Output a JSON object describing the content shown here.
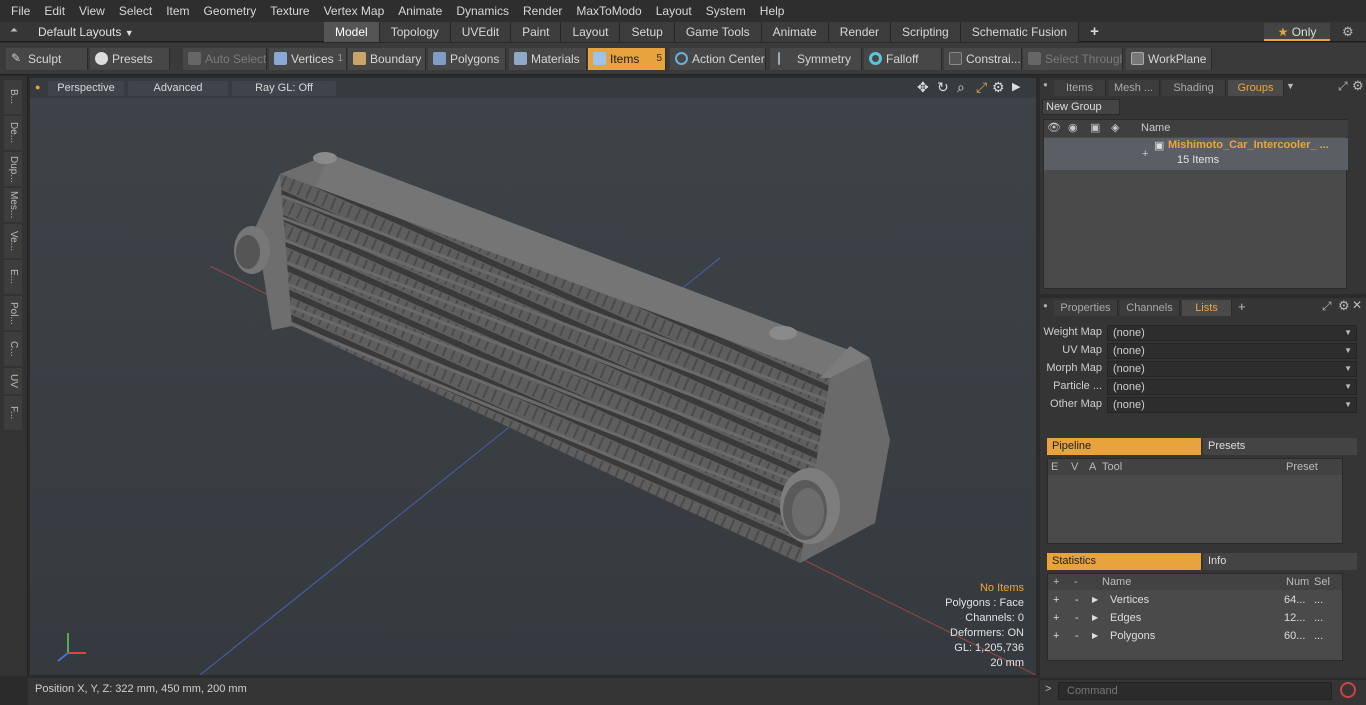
{
  "menu": [
    "File",
    "Edit",
    "View",
    "Select",
    "Item",
    "Geometry",
    "Texture",
    "Vertex Map",
    "Animate",
    "Dynamics",
    "Render",
    "MaxToModo",
    "Layout",
    "System",
    "Help"
  ],
  "layout_dropdown": "Default Layouts",
  "layout_tabs": [
    {
      "label": "Model",
      "active": true
    },
    {
      "label": "Topology"
    },
    {
      "label": "UVEdit"
    },
    {
      "label": "Paint"
    },
    {
      "label": "Layout"
    },
    {
      "label": "Setup"
    },
    {
      "label": "Game Tools"
    },
    {
      "label": "Animate"
    },
    {
      "label": "Render"
    },
    {
      "label": "Scripting"
    },
    {
      "label": "Schematic Fusion"
    }
  ],
  "add_tab": "+",
  "only_label": "Only",
  "toolbar": {
    "sculpt": "Sculpt",
    "presets": "Presets",
    "auto_select": "Auto Select",
    "vertices": "Vertices",
    "vertices_count": "1",
    "boundary": "Boundary",
    "polygons": "Polygons",
    "materials": "Materials",
    "items": "Items",
    "items_count": "5",
    "action_center": "Action Center",
    "symmetry": "Symmetry",
    "falloff": "Falloff",
    "constraints": "Constrai...",
    "select_through": "Select Through",
    "workplane": "WorkPlane"
  },
  "left_tabs": [
    "B...",
    "De...",
    "Dup...",
    "Mes...",
    "Ve...",
    "E...",
    "Pol...",
    "C...",
    "UV",
    "F..."
  ],
  "viewport": {
    "perspective": "Perspective",
    "advanced": "Advanced",
    "raygl": "Ray GL: Off",
    "info": {
      "no_items": "No Items",
      "polygons": "Polygons : Face",
      "channels": "Channels: 0",
      "deformers": "Deformers: ON",
      "gl": "GL: 1,205,736",
      "scale": "20 mm"
    }
  },
  "status_bar": "Position X, Y, Z:  322 mm, 450 mm, 200 mm",
  "groups_panel": {
    "tabs": [
      "Items",
      "Mesh ...",
      "Shading",
      "Groups"
    ],
    "new_group": "New Group",
    "name_header": "Name",
    "group_name": "Mishimoto_Car_Intercooler_ ...",
    "group_count": "15 Items"
  },
  "lists_panel": {
    "tabs": [
      "Properties",
      "Channels",
      "Lists"
    ],
    "maps": [
      {
        "label": "Weight Map",
        "value": "(none)"
      },
      {
        "label": "UV Map",
        "value": "(none)"
      },
      {
        "label": "Morph Map",
        "value": "(none)"
      },
      {
        "label": "Particle  ...",
        "value": "(none)"
      },
      {
        "label": "Other Map",
        "value": "(none)"
      }
    ],
    "pipeline": "Pipeline",
    "presets": "Presets",
    "pipeline_cols": [
      "E",
      "V",
      "A",
      "Tool",
      "Preset"
    ],
    "statistics": "Statistics",
    "info": "Info",
    "stats_cols": [
      "Name",
      "Num",
      "Sel"
    ],
    "stats_rows": [
      {
        "name": "Vertices",
        "num": "64...",
        "sel": "..."
      },
      {
        "name": "Edges",
        "num": "12...",
        "sel": "..."
      },
      {
        "name": "Polygons",
        "num": "60...",
        "sel": "..."
      }
    ]
  },
  "command_placeholder": "Command",
  "colors": {
    "accent": "#e8a33d",
    "viewport_bg": "#4b545c"
  }
}
